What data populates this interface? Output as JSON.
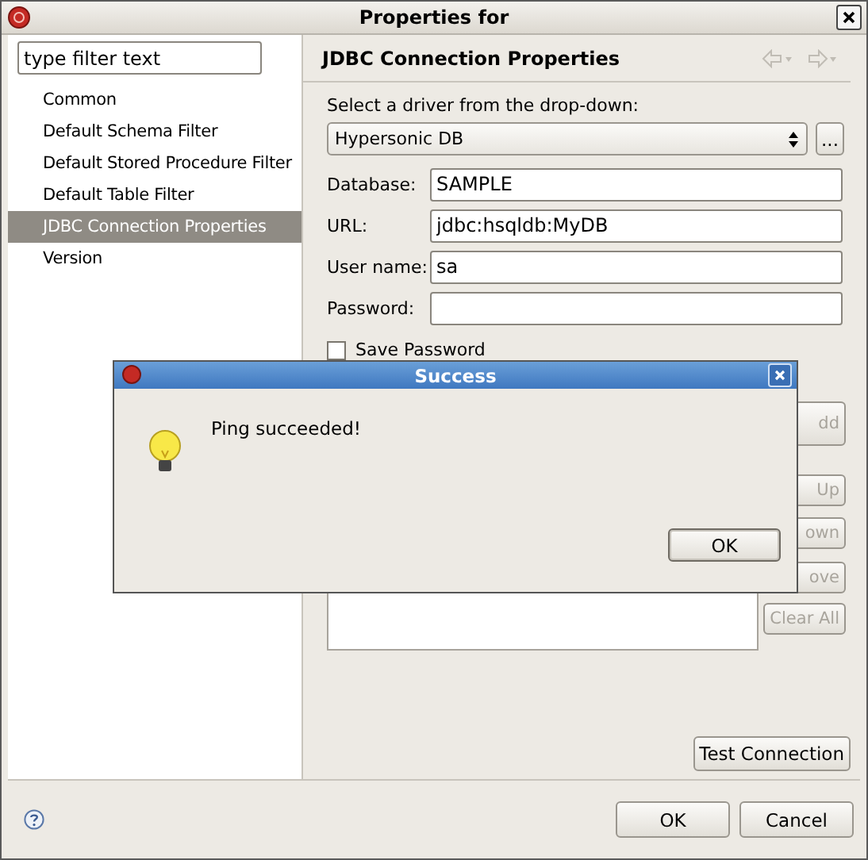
{
  "window": {
    "title": "Properties for"
  },
  "filter": {
    "value": "type filter text"
  },
  "sidebar": {
    "items": [
      {
        "label": "Common",
        "selected": false
      },
      {
        "label": "Default Schema Filter",
        "selected": false
      },
      {
        "label": "Default Stored Procedure Filter",
        "selected": false
      },
      {
        "label": "Default Table Filter",
        "selected": false
      },
      {
        "label": "JDBC Connection Properties",
        "selected": true
      },
      {
        "label": "Version",
        "selected": false
      }
    ]
  },
  "page": {
    "title": "JDBC Connection Properties",
    "driver_label": "Select a driver from the drop-down:",
    "driver": {
      "value": "Hypersonic DB"
    },
    "browse_button": "...",
    "fields": [
      {
        "label": "Database:",
        "value": "SAMPLE"
      },
      {
        "label": "URL:",
        "value": "jdbc:hsqldb:MyDB"
      },
      {
        "label": "User name:",
        "value": "sa"
      },
      {
        "label": "Password:"
      }
    ],
    "save_password": {
      "label": "Save Password",
      "checked": false
    },
    "side_buttons": [
      {
        "label": "dd",
        "disabled": true
      },
      {
        "label": "Up",
        "disabled": true
      },
      {
        "label": "own",
        "disabled": true
      },
      {
        "label": "ove",
        "disabled": true
      },
      {
        "label": "Clear All",
        "disabled": true
      }
    ],
    "test_button": "Test Connection"
  },
  "footer": {
    "buttons": [
      "OK",
      "Cancel"
    ]
  },
  "dialog": {
    "title": "Success",
    "message": "Ping succeeded!",
    "button": "OK"
  }
}
